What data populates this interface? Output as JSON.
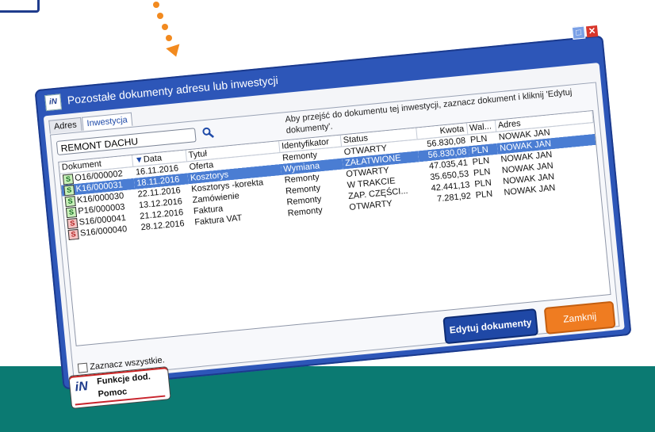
{
  "dialog": {
    "title": "Pozostałe dokumenty adresu lub inwestycji",
    "app_icon": "iN"
  },
  "tabs": [
    {
      "label": "Adres",
      "active": false
    },
    {
      "label": "Inwestycja",
      "active": true
    }
  ],
  "search": {
    "value": "REMONT DACHU",
    "icon": "search-icon"
  },
  "hint": "Aby przejść do dokumentu tej inwestycji, zaznacz dokument i kliknij 'Edytuj dokumenty'.",
  "grid": {
    "columns": [
      "Dokument",
      "Data",
      "Tytuł",
      "Identyfikator",
      "Status",
      "Kwota",
      "Wal...",
      "Adres"
    ],
    "sorted_column": "Data",
    "rows": [
      {
        "type": "S",
        "color": "green",
        "doc": "O16/000002",
        "date": "16.11.2016",
        "title": "Oferta",
        "id": "Remonty",
        "status": "OTWARTY",
        "amount": "56.830,08",
        "cur": "PLN",
        "addr": "NOWAK JAN",
        "selected": false
      },
      {
        "type": "S",
        "color": "green",
        "doc": "K16/000031",
        "date": "18.11.2016",
        "title": "Kosztorys",
        "id": "Wymiana",
        "status": "ZAŁATWIONE",
        "amount": "56.830,08",
        "cur": "PLN",
        "addr": "NOWAK JAN",
        "selected": true
      },
      {
        "type": "S",
        "color": "green",
        "doc": "K16/000030",
        "date": "22.11.2016",
        "title": "Kosztorys -korekta",
        "id": "Remonty",
        "status": "OTWARTY",
        "amount": "47.035,41",
        "cur": "PLN",
        "addr": "NOWAK JAN",
        "selected": false
      },
      {
        "type": "S",
        "color": "green",
        "doc": "P16/000003",
        "date": "13.12.2016",
        "title": "Zamówienie",
        "id": "Remonty",
        "status": "W TRAKCIE",
        "amount": "35.650,53",
        "cur": "PLN",
        "addr": "NOWAK JAN",
        "selected": false
      },
      {
        "type": "S",
        "color": "red",
        "doc": "S16/000041",
        "date": "21.12.2016",
        "title": "Faktura",
        "id": "Remonty",
        "status": "ZAP. CZĘŚCI...",
        "amount": "42.441,13",
        "cur": "PLN",
        "addr": "NOWAK JAN",
        "selected": false
      },
      {
        "type": "S",
        "color": "red",
        "doc": "S16/000040",
        "date": "28.12.2016",
        "title": "Faktura VAT",
        "id": "Remonty",
        "status": "OTWARTY",
        "amount": "7.281,92",
        "cur": "PLN",
        "addr": "NOWAK JAN",
        "selected": false
      }
    ]
  },
  "select_all_label": "Zaznacz wszystkie.",
  "buttons": {
    "edit": "Edytuj dokumenty",
    "close": "Zamknij"
  },
  "function_button": {
    "line1": "Funkcje dod.",
    "line2": "Pomoc",
    "logo": "iN"
  },
  "colors": {
    "dialog_frame": "#2d56b8",
    "selection": "#4a7dd3",
    "close_button": "#ef7c21",
    "edit_button": "#1f48a6",
    "teal_band": "#0b7a72",
    "arrow": "#f28a1f"
  }
}
